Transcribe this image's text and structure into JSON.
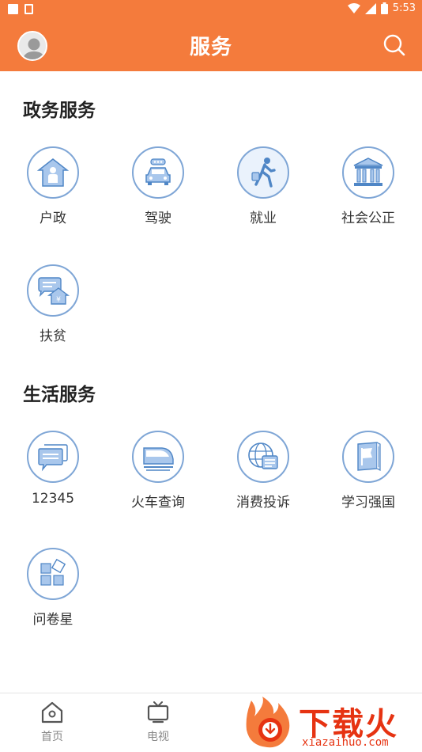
{
  "status_bar": {
    "time": "5:53"
  },
  "header": {
    "title": "服务"
  },
  "sections": [
    {
      "title": "政务服务",
      "items": [
        {
          "label": "户政",
          "icon": "household-registration-icon"
        },
        {
          "label": "驾驶",
          "icon": "car-driving-icon"
        },
        {
          "label": "就业",
          "icon": "employment-walking-person-icon"
        },
        {
          "label": "社会公正",
          "icon": "courthouse-icon"
        },
        {
          "label": "扶贫",
          "icon": "poverty-relief-house-icon"
        }
      ]
    },
    {
      "title": "生活服务",
      "items": [
        {
          "label": "12345",
          "icon": "hotline-chat-icon"
        },
        {
          "label": "火车查询",
          "icon": "train-icon"
        },
        {
          "label": "消费投诉",
          "icon": "consumer-complaint-globe-icon"
        },
        {
          "label": "学习强国",
          "icon": "study-book-flag-icon"
        },
        {
          "label": "问卷星",
          "icon": "questionnaire-blocks-icon"
        }
      ]
    }
  ],
  "bottom_nav": [
    {
      "label": "首页",
      "icon": "home-icon"
    },
    {
      "label": "电视",
      "icon": "tv-icon"
    }
  ],
  "watermark": {
    "text": "下载火",
    "url": "xiazaihuo.com"
  },
  "colors": {
    "accent": "#f47b3c",
    "icon_blue": "#7fa6d6",
    "icon_fill": "#a9c7ec"
  }
}
